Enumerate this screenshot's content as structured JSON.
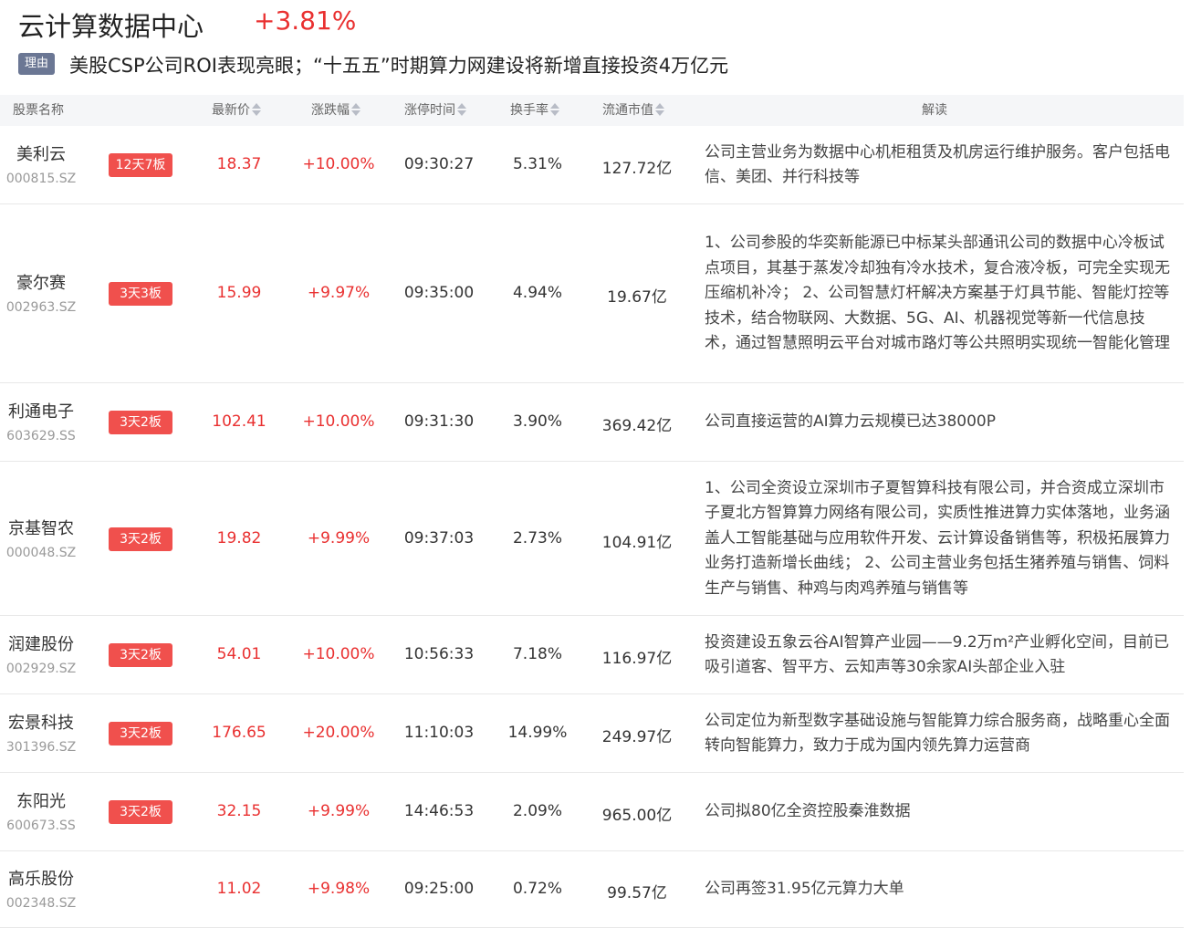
{
  "header": {
    "title": "云计算数据中心",
    "change": "+3.81%",
    "reason_tag": "理由",
    "reason_text": "美股CSP公司ROI表现亮眼；“十五五”时期算力网建设将新增直接投资4万亿元"
  },
  "columns": {
    "name": "股票名称",
    "price": "最新价",
    "pct": "涨跌幅",
    "time": "涨停时间",
    "turnover": "换手率",
    "cap": "流通市值",
    "desc": "解读"
  },
  "rows": [
    {
      "name": "美利云",
      "code": "000815.SZ",
      "badge": "12天7板",
      "price": "18.37",
      "pct": "+10.00%",
      "time": "09:30:27",
      "turnover": "5.31%",
      "cap": "127.72亿",
      "desc": "公司主营业务为数据中心机柜租赁及机房运行维护服务。客户包括电信、美团、并行科技等"
    },
    {
      "name": "豪尔赛",
      "code": "002963.SZ",
      "badge": "3天3板",
      "price": "15.99",
      "pct": "+9.97%",
      "time": "09:35:00",
      "turnover": "4.94%",
      "cap": "19.67亿",
      "desc": "1、公司参股的华奕新能源已中标某头部通讯公司的数据中心冷板试点项目，其基于蒸发冷却独有冷水技术，复合液冷板，可完全实现无压缩机补冷； 2、公司智慧灯杆解决方案基于灯具节能、智能灯控等技术，结合物联网、大数据、5G、AI、机器视觉等新一代信息技术，通过智慧照明云平台对城市路灯等公共照明实现统一智能化管理"
    },
    {
      "name": "利通电子",
      "code": "603629.SS",
      "badge": "3天2板",
      "price": "102.41",
      "pct": "+10.00%",
      "time": "09:31:30",
      "turnover": "3.90%",
      "cap": "369.42亿",
      "desc": "公司直接运营的AI算力云规模已达38000P"
    },
    {
      "name": "京基智农",
      "code": "000048.SZ",
      "badge": "3天2板",
      "price": "19.82",
      "pct": "+9.99%",
      "time": "09:37:03",
      "turnover": "2.73%",
      "cap": "104.91亿",
      "desc": "1、公司全资设立深圳市子夏智算科技有限公司，并合资成立深圳市子夏北方智算算力网络有限公司，实质性推进算力实体落地，业务涵盖人工智能基础与应用软件开发、云计算设备销售等，积极拓展算力业务打造新增长曲线； 2、公司主营业务包括生猪养殖与销售、饲料生产与销售、种鸡与肉鸡养殖与销售等"
    },
    {
      "name": "润建股份",
      "code": "002929.SZ",
      "badge": "3天2板",
      "price": "54.01",
      "pct": "+10.00%",
      "time": "10:56:33",
      "turnover": "7.18%",
      "cap": "116.97亿",
      "desc": "投资建设五象云谷AI智算产业园——9.2万m²产业孵化空间，目前已吸引道客、智平方、云知声等30余家AI头部企业入驻"
    },
    {
      "name": "宏景科技",
      "code": "301396.SZ",
      "badge": "3天2板",
      "price": "176.65",
      "pct": "+20.00%",
      "time": "11:10:03",
      "turnover": "14.99%",
      "cap": "249.97亿",
      "desc": "公司定位为新型数字基础设施与智能算力综合服务商，战略重心全面转向智能算力，致力于成为国内领先算力运营商"
    },
    {
      "name": "东阳光",
      "code": "600673.SS",
      "badge": "3天2板",
      "price": "32.15",
      "pct": "+9.99%",
      "time": "14:46:53",
      "turnover": "2.09%",
      "cap": "965.00亿",
      "desc": "公司拟80亿全资控股秦淮数据"
    },
    {
      "name": "高乐股份",
      "code": "002348.SZ",
      "badge": "",
      "price": "11.02",
      "pct": "+9.98%",
      "time": "09:25:00",
      "turnover": "0.72%",
      "cap": "99.57亿",
      "desc": "公司再签31.95亿元算力大单"
    }
  ],
  "colors": {
    "up": "#e93030",
    "badge_bg": "#f0504d",
    "tag_bg": "#6b7794",
    "header_bg": "#f5f6f8"
  },
  "icons": {
    "sort": "sort-arrows-icon"
  }
}
